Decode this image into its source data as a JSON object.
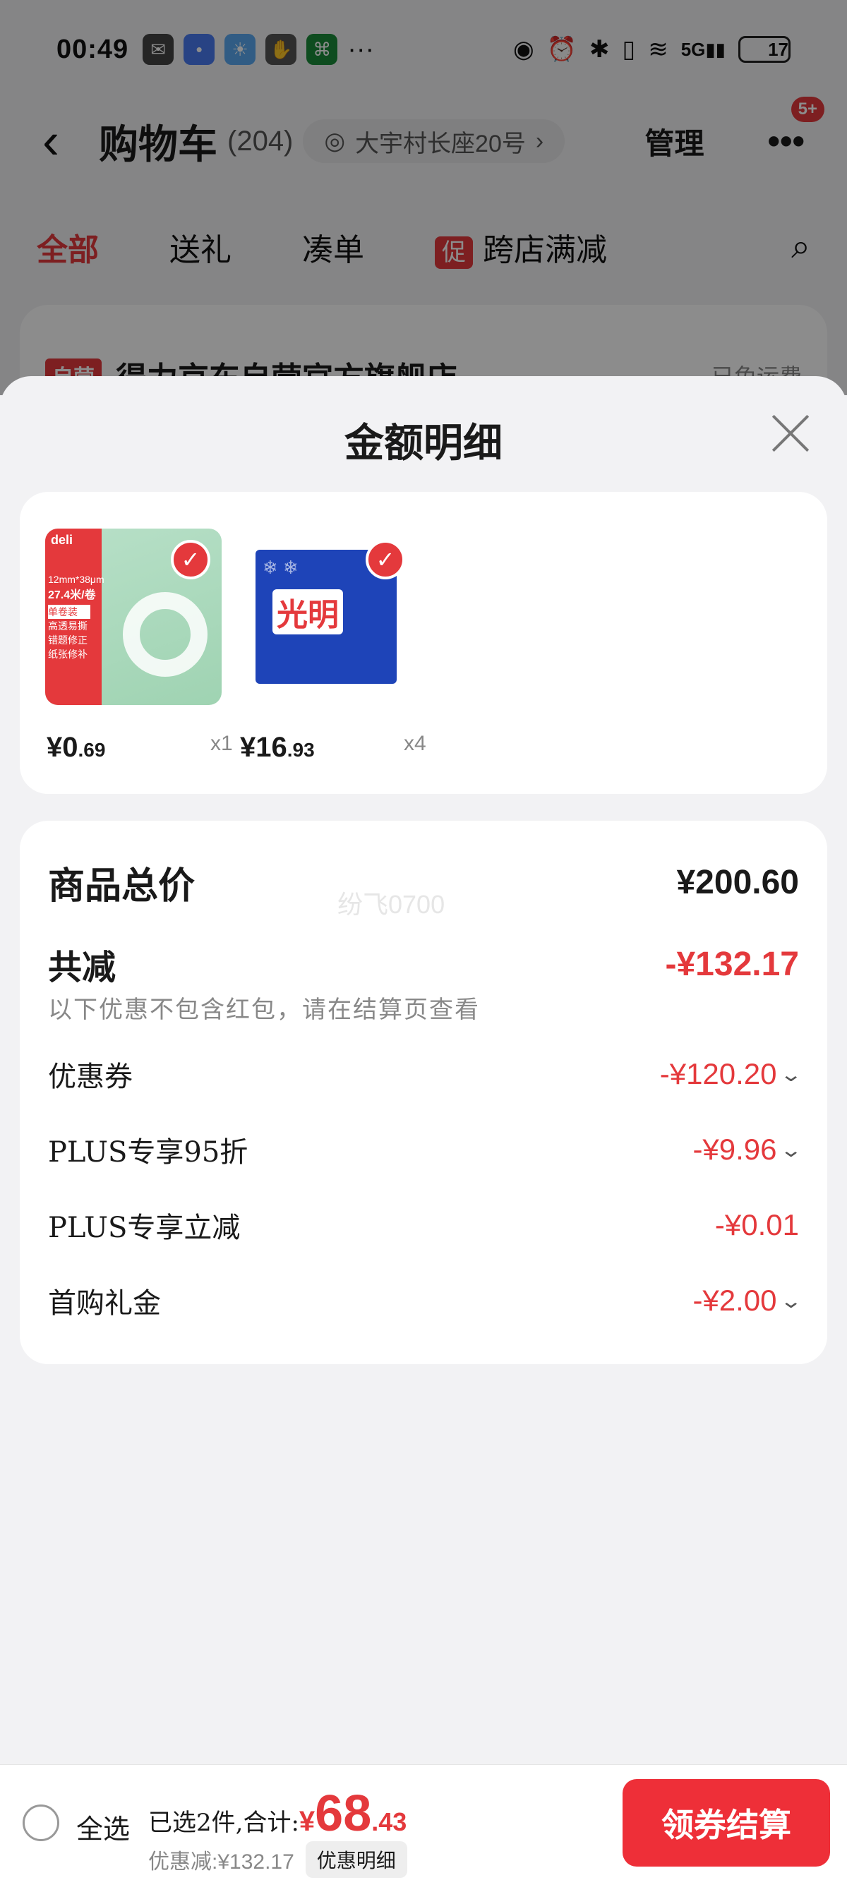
{
  "status_bar": {
    "time": "00:49",
    "battery": "17",
    "network": "5G"
  },
  "header": {
    "back_icon": "back-arrow-icon",
    "title": "购物车",
    "count": "(204)",
    "address": "大宇村长座20号",
    "manage": "管理",
    "more_badge": "5+"
  },
  "tabs": {
    "all": "全部",
    "gift": "送礼",
    "bundle": "凑单",
    "promo_tag": "促",
    "cross_store": "跨店满减"
  },
  "store": {
    "tag": "自营",
    "name": "得力京东自营官方旗舰店",
    "shipping": "已免运费"
  },
  "sheet": {
    "title": "金额明细",
    "items": [
      {
        "price_int": "¥0",
        "price_dec": ".69",
        "qty": "x1"
      },
      {
        "price_int": "¥16",
        "price_dec": ".93",
        "qty": "x4"
      }
    ],
    "item1_image": {
      "brand": "deli",
      "spec": "12mm*38μm",
      "length": "27.4米/卷",
      "tags": [
        "单卷装",
        "高透易撕",
        "错题修正",
        "纸张修补"
      ]
    },
    "item2_image": {
      "brand": "光明"
    },
    "watermark": "纷飞0700",
    "total_label": "商品总价",
    "total_value": "¥200.60",
    "reduce_label": "共减",
    "reduce_value": "-¥132.17",
    "note": "以下优惠不包含红包，请在结算页查看",
    "discounts": [
      {
        "label": "优惠券",
        "value": "-¥120.20"
      },
      {
        "label": "PLUS专享95折",
        "value": "-¥9.96"
      },
      {
        "label": "PLUS专享立减",
        "value": "-¥0.01"
      },
      {
        "label": "首购礼金",
        "value": "-¥2.00"
      }
    ]
  },
  "bottom": {
    "select_all": "全选",
    "summary": "已选2件,合计:",
    "total_currency": "¥",
    "total_int": "68",
    "total_dec": ".43",
    "discount": "优惠减:¥132.17",
    "detail_button": "优惠明细",
    "checkout": "领券结算"
  },
  "colors": {
    "accent": "#e4393c",
    "checkout": "#ee2f38"
  }
}
